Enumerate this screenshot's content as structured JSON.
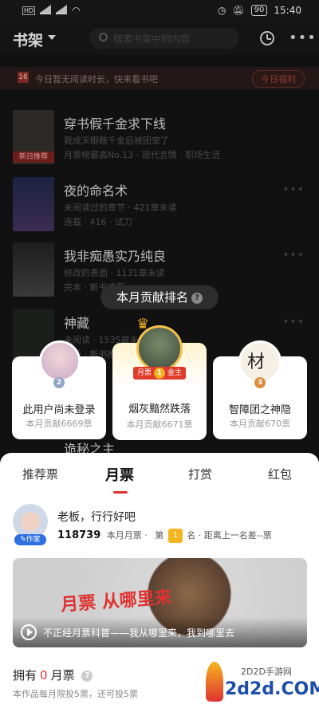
{
  "status_bar": {
    "left": [
      "HD",
      "46",
      "HD",
      "46"
    ],
    "battery": "90",
    "time": "15:40"
  },
  "header": {
    "title": "书架",
    "search_placeholder": "搜索书架中的内容"
  },
  "notice": {
    "tag": "16",
    "text": "今日暂无阅读时长，快来看书吧",
    "button": "今日福利"
  },
  "books": [
    {
      "title": "穿书假千金求下线",
      "line1": "我成天眼瞎千金后被团宠了",
      "line2": "月票榜最高No.13 · 现代言情 · 职场生活",
      "badge": "新日推荐"
    },
    {
      "title": "夜的命名术",
      "line1": "未阅读过的章节 · 421章未读",
      "line2": "连载 · 416 · 试刀"
    },
    {
      "title": "我非痴愚实乃纯良",
      "line1": "修改的表面 · 1131章未读",
      "line2": "完本 · 新书推荐"
    },
    {
      "title": "神藏",
      "line1": "未阅读 · 1535章未读",
      "line2": "连载 · 新书推荐"
    },
    {
      "title": "诡秘之主",
      "line1": "",
      "line2": ""
    }
  ],
  "ranking": {
    "title": "本月贡献排名",
    "help_icon": "?",
    "entries": [
      {
        "rank": "2",
        "name": "此用户尚未登录",
        "votes": "本月贡献6669票"
      },
      {
        "rank": "1",
        "name": "烟灰黯然跌落",
        "votes": "本月贡献6671票",
        "badge_left": "月票",
        "badge_right": "金主"
      },
      {
        "rank": "3",
        "name": "智障团之神隐",
        "votes": "本月贡献670票"
      }
    ]
  },
  "sheet": {
    "tabs": [
      "推荐票",
      "月票",
      "打赏",
      "红包"
    ],
    "active_tab": "月票",
    "greeting": "老板，行行好吧",
    "author_badge": "作家",
    "votes_count": "118739",
    "votes_label": "本月月票 ·",
    "rank_prefix": "第",
    "rank_value": "1",
    "rank_suffix": "名 · 距离上一名差--票",
    "video_caption": "不正经月票科普——我从哪里来，我到哪里去",
    "video_overlay_text": "月票 从哪里来",
    "own_prefix": "拥有",
    "own_value": "0",
    "own_suffix": "月票",
    "own_sub": "本作品每月限投5票，还可投5票",
    "watermark_top": "2D2D手游网",
    "watermark_bottom": "2d2d.COM"
  }
}
